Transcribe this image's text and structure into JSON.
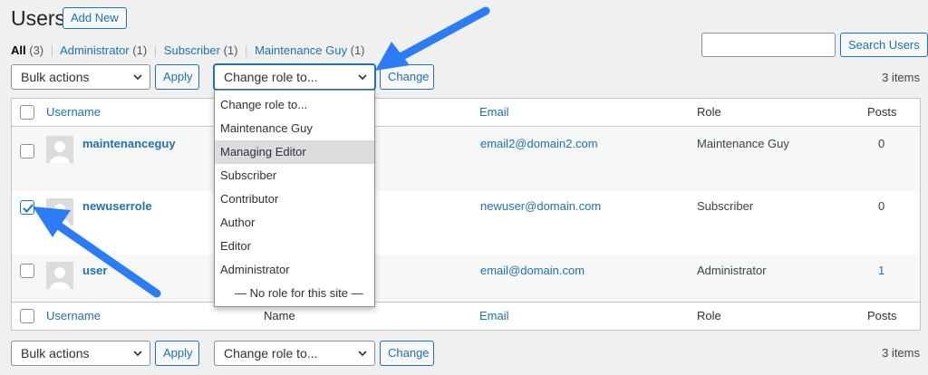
{
  "header": {
    "title": "Users",
    "add_new": "Add New"
  },
  "filters": {
    "all": "All",
    "all_count": "(3)",
    "administrator": "Administrator",
    "administrator_count": "(1)",
    "subscriber": "Subscriber",
    "subscriber_count": "(1)",
    "maintenance": "Maintenance Guy",
    "maintenance_count": "(1)",
    "separator": "|"
  },
  "search": {
    "value": "",
    "button": "Search Users"
  },
  "top_nav": {
    "bulk_actions": "Bulk actions",
    "apply": "Apply",
    "change_role": "Change role to...",
    "change": "Change",
    "items": "3 items"
  },
  "bottom_nav": {
    "bulk_actions": "Bulk actions",
    "apply": "Apply",
    "change_role": "Change role to...",
    "change": "Change",
    "items": "3 items"
  },
  "table": {
    "columns": {
      "username": "Username",
      "name": "Name",
      "email": "Email",
      "role": "Role",
      "posts": "Posts"
    },
    "rows": [
      {
        "username": "maintenanceguy",
        "email": "email2@domain2.com",
        "role": "Maintenance Guy",
        "posts": "0",
        "checked": false
      },
      {
        "username": "newuserrole",
        "email": "newuser@domain.com",
        "role": "Subscriber",
        "posts": "0",
        "checked": true
      },
      {
        "username": "user",
        "email": "email@domain.com",
        "role": "Administrator",
        "posts": "1",
        "checked": false
      }
    ]
  },
  "dropdown": {
    "options": [
      "Change role to...",
      "Maintenance Guy",
      "Managing Editor",
      "Subscriber",
      "Contributor",
      "Author",
      "Editor",
      "Administrator",
      "— No role for this site —"
    ],
    "highlighted": "Managing Editor"
  },
  "colors": {
    "accent": "#2271b1",
    "arrow": "#2c7cf6",
    "page_bg": "#f0f0f1"
  },
  "icons": {
    "chevron": "chevron-down-icon",
    "check": "checkmark-icon",
    "avatar": "avatar-placeholder-icon",
    "annotation": "callout-arrow"
  }
}
